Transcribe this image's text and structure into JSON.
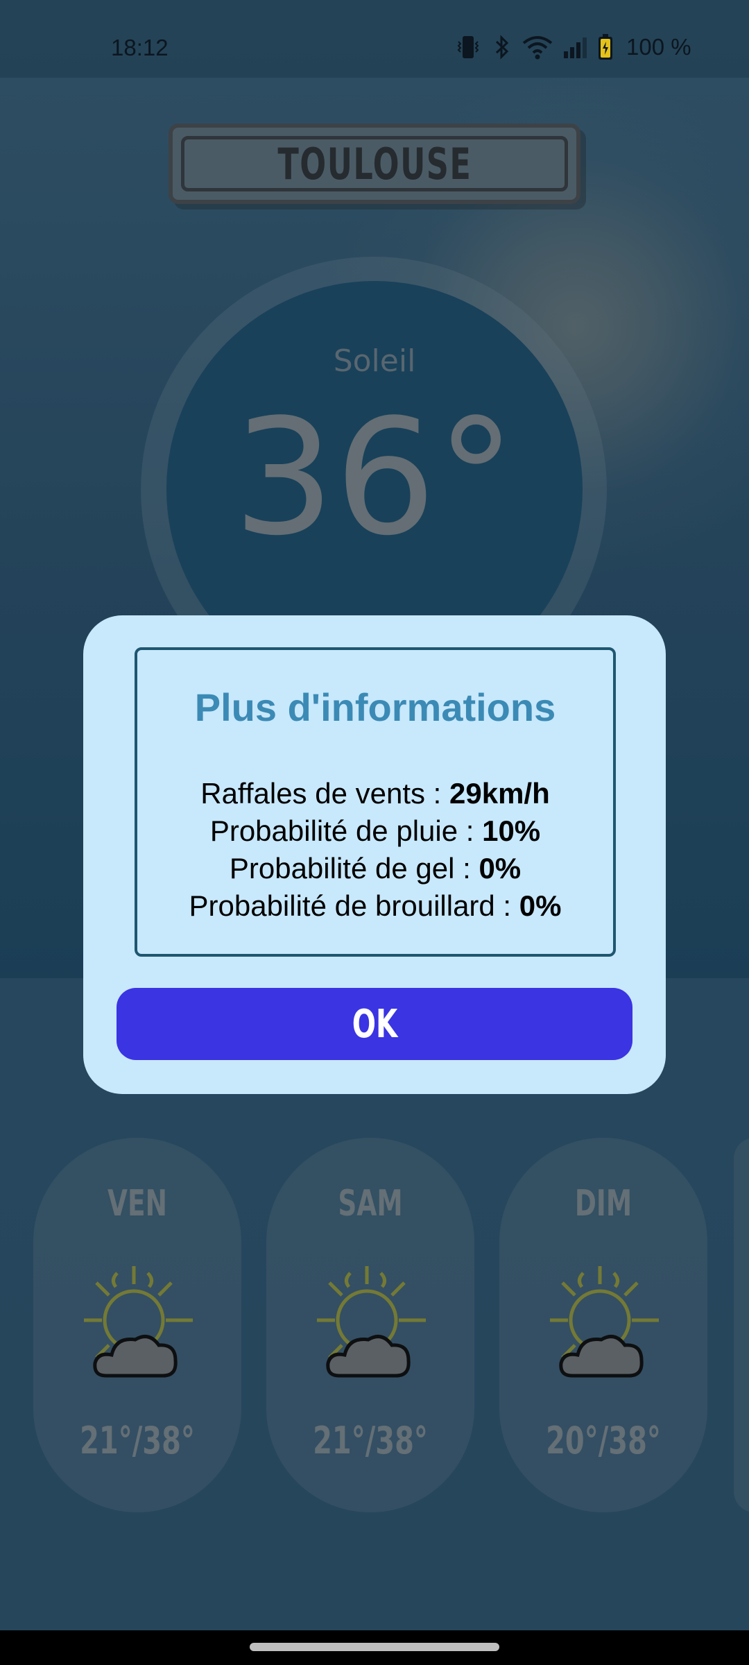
{
  "status_bar": {
    "time": "18:12",
    "battery": "100 %",
    "icons": [
      "vibrate-icon",
      "bluetooth-icon",
      "wifi-icon",
      "signal-icon",
      "battery-icon"
    ]
  },
  "city": {
    "name": "TOULOUSE"
  },
  "current": {
    "condition": "Soleil",
    "temperature": "36°"
  },
  "forecast": [
    {
      "day": "VEN",
      "temps": "21°/38°",
      "icon": "sun-cloud-icon"
    },
    {
      "day": "SAM",
      "temps": "21°/38°",
      "icon": "sun-cloud-icon"
    },
    {
      "day": "DIM",
      "temps": "20°/38°",
      "icon": "sun-cloud-icon"
    }
  ],
  "dialog": {
    "title": "Plus d'informations",
    "lines": [
      {
        "label": "Raffales de vents : ",
        "value": "29km/h"
      },
      {
        "label": "Probabilité de pluie : ",
        "value": "10%"
      },
      {
        "label": "Probabilité de gel : ",
        "value": "0%"
      },
      {
        "label": "Probabilité de brouillard : ",
        "value": "0%"
      }
    ],
    "ok_label": "OK"
  },
  "colors": {
    "dialog_bg": "#c8e8fb",
    "title": "#3b8ab5",
    "ok_button": "#3a34e3"
  }
}
